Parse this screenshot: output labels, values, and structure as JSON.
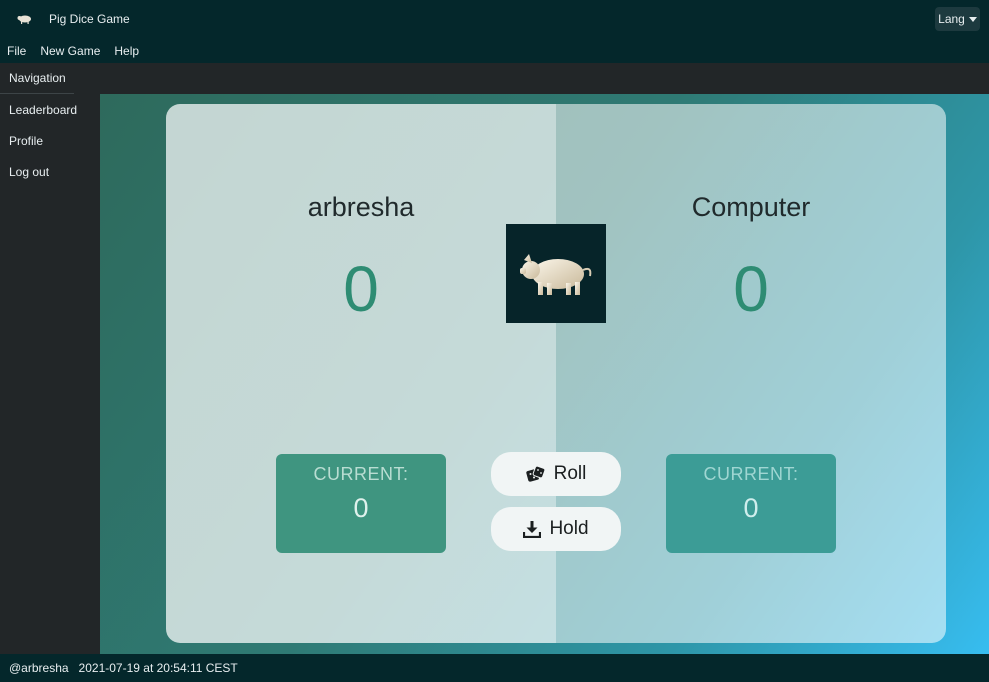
{
  "window": {
    "title": "Pig Dice Game",
    "lang_label": "Lang"
  },
  "menu": {
    "items": [
      "File",
      "New Game",
      "Help"
    ]
  },
  "sidebar": {
    "header": "Navigation",
    "links": [
      "Leaderboard",
      "Profile",
      "Log out"
    ]
  },
  "game": {
    "player1": {
      "name": "arbresha",
      "score": "0",
      "current_label": "CURRENT:",
      "current_value": "0"
    },
    "player2": {
      "name": "Computer",
      "score": "0",
      "current_label": "CURRENT:",
      "current_value": "0"
    },
    "roll_label": "Roll",
    "hold_label": "Hold"
  },
  "status": {
    "user": "@arbresha",
    "timestamp": "2021-07-19 at 20:54:11 CEST"
  },
  "colors": {
    "score": "#2e8c73",
    "titlebar": "#04272b",
    "sidebar": "#222628"
  }
}
